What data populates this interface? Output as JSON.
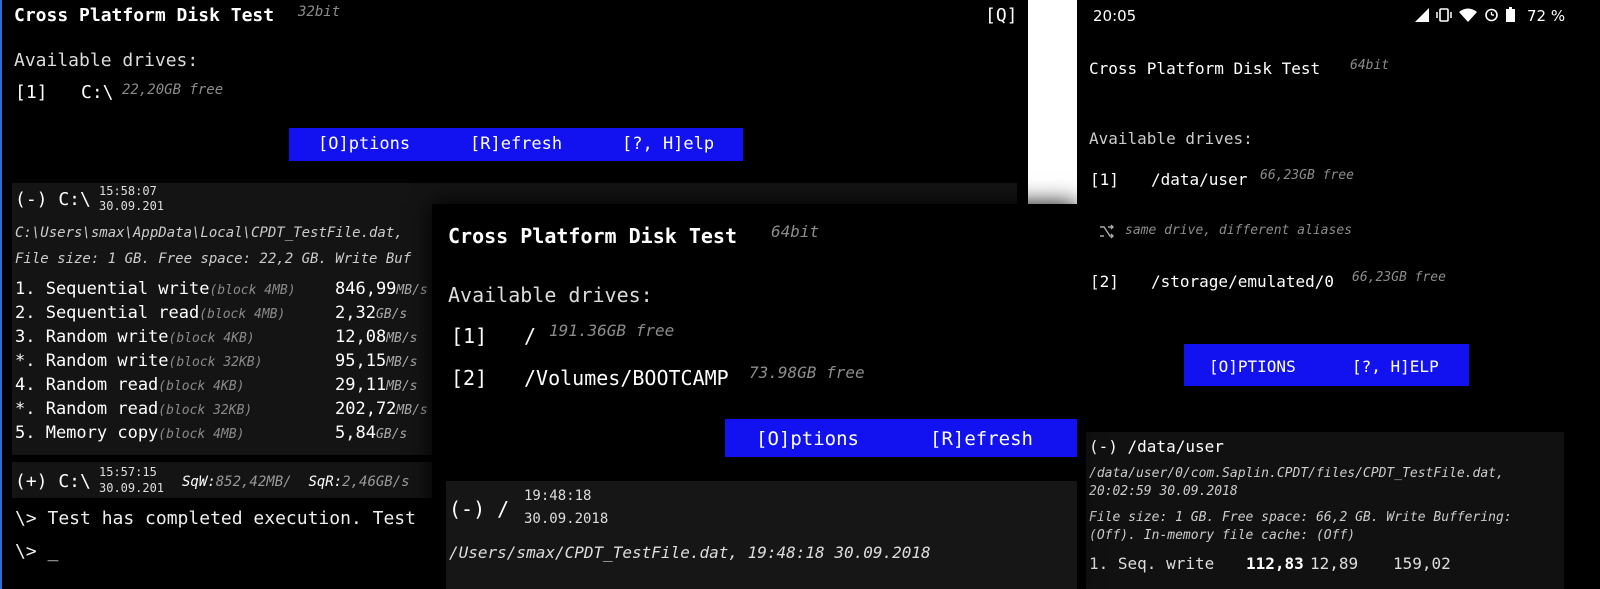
{
  "win1": {
    "title": "Cross Platform Disk Test",
    "bits": "32bit",
    "quit": "[Q]",
    "drives_label": "Available drives:",
    "drives": [
      {
        "key": "[1]",
        "path": "C:\\",
        "free": "22,20GB free"
      }
    ],
    "buttons": {
      "options": "[O]ptions",
      "refresh": "[R]efresh",
      "help": "[?, H]elp"
    },
    "result1": {
      "marker": "(-) C:\\",
      "time": "15:58:07",
      "date": "30.09.201",
      "file_path": "C:\\Users\\smax\\AppData\\Local\\CPDT_TestFile.dat,",
      "file_info": "File size: 1 GB. Free space: 22,2 GB. Write Buf",
      "rows": [
        {
          "name": "1. Sequential write",
          "block": "(block 4MB)",
          "value": "846,99",
          "unit": "MB/s"
        },
        {
          "name": "2. Sequential read",
          "block": "(block 4MB)",
          "value": "2,32",
          "unit": "GB/s"
        },
        {
          "name": "3. Random write",
          "block": "(block 4KB)",
          "value": "12,08",
          "unit": "MB/s"
        },
        {
          "name": "*. Random write",
          "block": "(block 32KB)",
          "value": "95,15",
          "unit": "MB/s"
        },
        {
          "name": "4. Random read",
          "block": "(block 4KB)",
          "value": "29,11",
          "unit": "MB/s"
        },
        {
          "name": "*. Random read",
          "block": "(block 32KB)",
          "value": "202,72",
          "unit": "MB/s"
        },
        {
          "name": "5. Memory copy",
          "block": "(block 4MB)",
          "value": "5,84",
          "unit": "GB/s"
        }
      ]
    },
    "result2": {
      "marker": "(+) C:\\",
      "time": "15:57:15",
      "date": "30.09.201",
      "sqw_label": "SqW:",
      "sqw": "852,42MB/",
      "sqr_label": "SqR:",
      "sqr": "2,46GB/s"
    },
    "console": [
      "\\> Test has completed execution. Test",
      "\\> _"
    ]
  },
  "win2": {
    "title": "Cross Platform Disk Test",
    "bits": "64bit",
    "drives_label": "Available drives:",
    "drives": [
      {
        "key": "[1]",
        "path": "/",
        "free": "191.36GB free"
      },
      {
        "key": "[2]",
        "path": "/Volumes/BOOTCAMP",
        "free": "73.98GB free"
      }
    ],
    "buttons": {
      "options": "[O]ptions",
      "refresh": "[R]efresh"
    },
    "result": {
      "marker": "(-) /",
      "time": "19:48:18",
      "date": "30.09.2018",
      "file_path": "/Users/smax/CPDT_TestFile.dat, 19:48:18 30.09.2018"
    }
  },
  "win3": {
    "status": {
      "time": "20:05",
      "battery": "72 %"
    },
    "title": "Cross Platform Disk Test",
    "bits": "64bit",
    "drives_label": "Available drives:",
    "drives": [
      {
        "key": "[1]",
        "path": "/data/user",
        "free": "66,23GB free"
      },
      {
        "key": "[2]",
        "path": "/storage/emulated/0",
        "free": "66,23GB free"
      }
    ],
    "alias_note": "same drive, different aliases",
    "buttons": {
      "options": "[O]PTIONS",
      "help": "[?, H]ELP"
    },
    "result": {
      "marker": "(-) /data/user",
      "file_path": "/data/user/0/com.Saplin.CPDT/files/CPDT_TestFile.dat,",
      "file_time": "20:02:59 30.09.2018",
      "file_info1": "File size: 1 GB. Free space: 66,2 GB. Write Buffering:",
      "file_info2": "(Off). In-memory file cache: (Off)",
      "row": {
        "name": "1. Seq. write",
        "v1": "112,83",
        "v2": "12,89",
        "v3": "159,02"
      }
    }
  }
}
